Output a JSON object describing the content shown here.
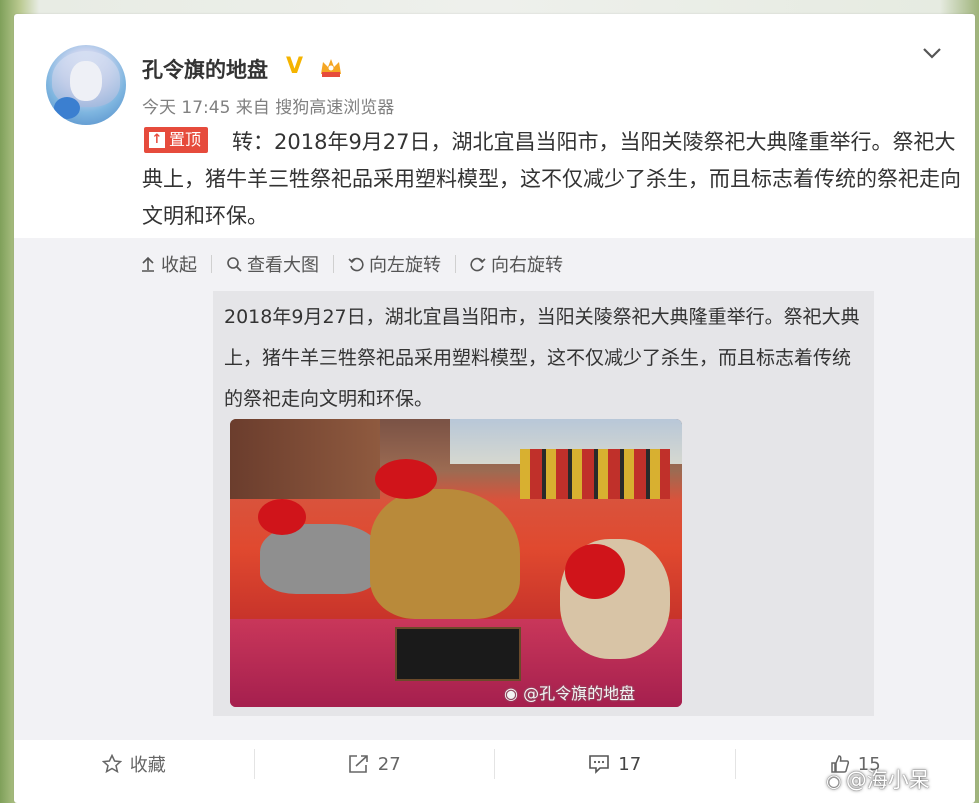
{
  "user": {
    "nickname": "孔令旗的地盘",
    "verified_mark": "V",
    "meta": "今天 17:45 来自 搜狗高速浏览器"
  },
  "post": {
    "pin_label": "置顶",
    "text": "转：2018年9月27日，湖北宜昌当阳市，当阳关陵祭祀大典隆重举行。祭祀大典上，猪牛羊三牲祭祀品采用塑料模型，这不仅减少了杀生，而且标志着传统的祭祀走向文明和环保。"
  },
  "media_toolbar": {
    "collapse": "收起",
    "view_large": "查看大图",
    "rotate_left": "向左旋转",
    "rotate_right": "向右旋转"
  },
  "original": {
    "text": "2018年9月27日，湖北宜昌当阳市，当阳关陵祭祀大典隆重举行。祭祀大典上，猪牛羊三牲祭祀品采用塑料模型，这不仅减少了杀生，而且标志着传统的祭祀走向文明和环保。",
    "photo_watermark": "@孔令旗的地盘"
  },
  "actions": {
    "favorite": "收藏",
    "repost_count": "27",
    "comment_count": "17",
    "like_count": "15"
  },
  "page_watermark": "@海小呆",
  "colors": {
    "pin_red": "#e64b3c",
    "verified_gold": "#f5b400",
    "text": "#333333",
    "meta_gray": "#808080"
  }
}
